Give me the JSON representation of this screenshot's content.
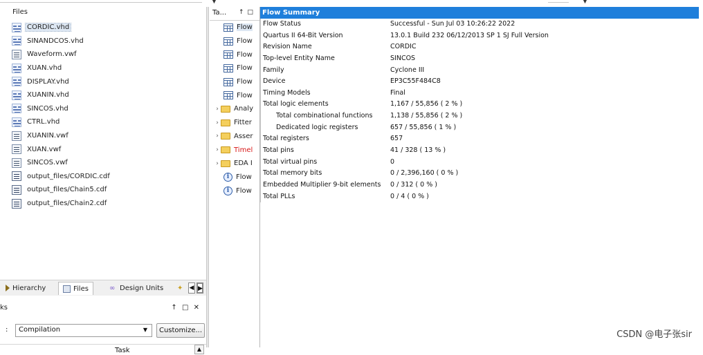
{
  "files_panel": {
    "header": "Files",
    "files": [
      {
        "name": "CORDIC.vhd",
        "icon": "vhdl-file-icon",
        "type": "vhd",
        "selected": true
      },
      {
        "name": "SINANDCOS.vhd",
        "icon": "vhdl-file-icon",
        "type": "vhd"
      },
      {
        "name": "Waveform.vwf",
        "icon": "waveform-file-icon",
        "type": "vwf"
      },
      {
        "name": "XUAN.vhd",
        "icon": "vhdl-file-icon",
        "type": "vhd"
      },
      {
        "name": "DISPLAY.vhd",
        "icon": "vhdl-file-icon",
        "type": "vhd"
      },
      {
        "name": "XUANIN.vhd",
        "icon": "vhdl-file-icon",
        "type": "vhd"
      },
      {
        "name": "SINCOS.vhd",
        "icon": "vhdl-file-icon",
        "type": "vhd"
      },
      {
        "name": "CTRL.vhd",
        "icon": "vhdl-file-icon",
        "type": "vhd"
      },
      {
        "name": "XUANIN.vwf",
        "icon": "waveform-file-icon",
        "type": "vwf"
      },
      {
        "name": "XUAN.vwf",
        "icon": "waveform-file-icon",
        "type": "vwf"
      },
      {
        "name": "SINCOS.vwf",
        "icon": "waveform-file-icon",
        "type": "vwf"
      },
      {
        "name": "output_files/CORDIC.cdf",
        "icon": "chain-file-icon",
        "type": "cdf"
      },
      {
        "name": "output_files/Chain5.cdf",
        "icon": "chain-file-icon",
        "type": "cdf"
      },
      {
        "name": "output_files/Chain2.cdf",
        "icon": "chain-file-icon",
        "type": "cdf"
      }
    ]
  },
  "nav_tabs": {
    "hierarchy": "Hierarchy",
    "files": "Files",
    "design_units": "Design Units"
  },
  "tasks_panel": {
    "title": "ks",
    "controls": "↑ □ ✕",
    "flow_label": ":",
    "flow_value": "Compilation",
    "customize": "Customize...",
    "task_column": "Task"
  },
  "toc_panel": {
    "title": "Ta...",
    "controls": "↑ □",
    "items": [
      {
        "label": "Flow",
        "icon": "table-icon",
        "expandable": false,
        "selected": true
      },
      {
        "label": "Flow",
        "icon": "table-icon",
        "expandable": false
      },
      {
        "label": "Flow",
        "icon": "table-icon",
        "expandable": false
      },
      {
        "label": "Flow",
        "icon": "table-icon",
        "expandable": false
      },
      {
        "label": "Flow",
        "icon": "table-icon",
        "expandable": false
      },
      {
        "label": "Flow",
        "icon": "table-icon",
        "expandable": false
      },
      {
        "label": "Analy",
        "icon": "folder-icon",
        "expandable": true
      },
      {
        "label": "Fitter",
        "icon": "folder-icon",
        "expandable": true
      },
      {
        "label": "Asser",
        "icon": "folder-icon",
        "expandable": true
      },
      {
        "label": "Timel",
        "icon": "folder-icon",
        "expandable": true,
        "red": true
      },
      {
        "label": "EDA I",
        "icon": "folder-icon",
        "expandable": true
      },
      {
        "label": "Flow",
        "icon": "info-icon",
        "expandable": false
      },
      {
        "label": "Flow",
        "icon": "info-icon",
        "expandable": false
      }
    ]
  },
  "flow_summary": {
    "title": "Flow Summary",
    "rows": [
      {
        "key": "Flow Status",
        "value": "Successful - Sun Jul 03 10:26:22 2022"
      },
      {
        "key": "Quartus II 64-Bit Version",
        "value": "13.0.1 Build 232 06/12/2013 SP 1 SJ Full Version"
      },
      {
        "key": "Revision Name",
        "value": "CORDIC"
      },
      {
        "key": "Top-level Entity Name",
        "value": "SINCOS"
      },
      {
        "key": "Family",
        "value": "Cyclone III"
      },
      {
        "key": "Device",
        "value": "EP3C55F484C8"
      },
      {
        "key": "Timing Models",
        "value": "Final"
      },
      {
        "key": "Total logic elements",
        "value": "1,167 / 55,856 ( 2 % )"
      },
      {
        "key": "Total combinational functions",
        "value": "1,138 / 55,856 ( 2 % )",
        "indent": true
      },
      {
        "key": "Dedicated logic registers",
        "value": "657 / 55,856 ( 1 % )",
        "indent": true
      },
      {
        "key": "Total registers",
        "value": "657"
      },
      {
        "key": "Total pins",
        "value": "41 / 328 ( 13 % )"
      },
      {
        "key": "Total virtual pins",
        "value": "0"
      },
      {
        "key": "Total memory bits",
        "value": "0 / 2,396,160 ( 0 % )"
      },
      {
        "key": "Embedded Multiplier 9-bit elements",
        "value": "0 / 312 ( 0 % )"
      },
      {
        "key": "Total PLLs",
        "value": "0 / 4 ( 0 % )"
      }
    ]
  },
  "watermark": "CSDN @电子张sir",
  "colors": {
    "header_blue": "#1f7fdb",
    "selection": "#dde7f3",
    "timing_red": "#d81818"
  }
}
